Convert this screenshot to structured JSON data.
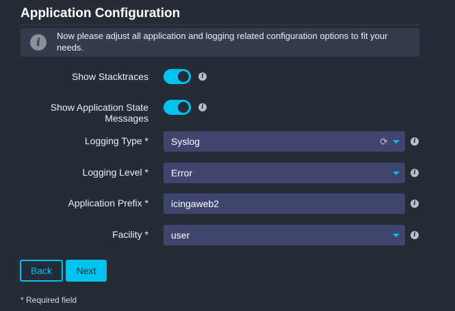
{
  "page": {
    "title": "Application Configuration",
    "info": {
      "icon": "info-icon",
      "text": "Now please adjust all application and logging related configuration options to fit your needs."
    }
  },
  "form": {
    "show_stacktraces": {
      "label": "Show Stacktraces",
      "enabled": true
    },
    "show_app_state": {
      "label": "Show Application State Messages",
      "enabled": true
    },
    "logging_type": {
      "label": "Logging Type *",
      "value": "Syslog"
    },
    "logging_level": {
      "label": "Logging Level *",
      "value": "Error"
    },
    "application_prefix": {
      "label": "Application Prefix *",
      "value": "icingaweb2"
    },
    "facility": {
      "label": "Facility *",
      "value": "user"
    }
  },
  "buttons": {
    "back": "Back",
    "next": "Next"
  },
  "footer": {
    "required_note": "* Required field"
  },
  "colors": {
    "accent": "#00c3ed",
    "background": "#262b38",
    "control": "#3e4670",
    "info_box": "#353b4b"
  }
}
